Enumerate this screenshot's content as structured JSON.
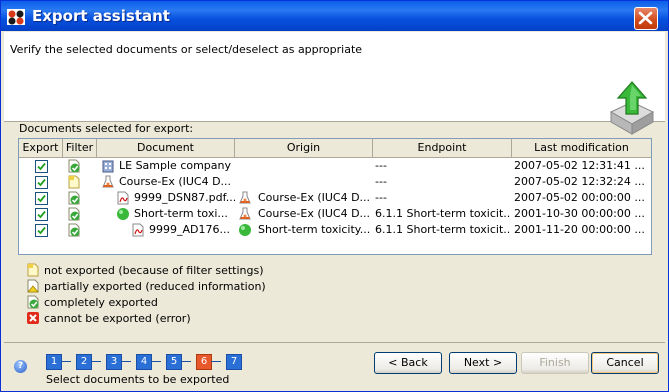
{
  "window": {
    "title": "Export assistant"
  },
  "header": {
    "instruction": "Verify the selected documents or select/deselect as appropriate"
  },
  "table": {
    "label": "Documents selected for export:",
    "columns": [
      "Export",
      "Filter",
      "Document",
      "Origin",
      "Endpoint",
      "Last modification"
    ],
    "rows": [
      {
        "export": true,
        "filter": "completely-exported",
        "doc_icon": "company-icon",
        "document": "LE Sample company",
        "origin_icon": "",
        "origin": "",
        "endpoint": "---",
        "modified": "2007-05-02 12:31:41 ..."
      },
      {
        "export": true,
        "filter": "not-exported",
        "doc_icon": "flask-icon",
        "document": "Course-Ex (IUC4 D...",
        "origin_icon": "",
        "origin": "",
        "endpoint": "---",
        "modified": "2007-05-02 12:32:24 ..."
      },
      {
        "export": true,
        "filter": "completely-exported",
        "doc_icon": "pdf-icon",
        "document": "9999_DSN87.pdf...",
        "origin_icon": "flask-icon",
        "origin": "Course-Ex (IUC4 D...",
        "endpoint": "---",
        "modified": "2007-05-02 00:00:00 ..."
      },
      {
        "export": true,
        "filter": "completely-exported",
        "doc_icon": "green-ball-icon",
        "document": "Short-term toxi...",
        "origin_icon": "flask-icon",
        "origin": "Course-Ex (IUC4 D...",
        "endpoint": "6.1.1 Short-term toxicit...",
        "modified": "2001-10-30 00:00:00 ..."
      },
      {
        "export": true,
        "filter": "completely-exported",
        "doc_icon": "pdf-icon",
        "document": "9999_AD176...",
        "origin_icon": "green-ball-icon",
        "origin": "Short-term toxicity...",
        "endpoint": "6.1.1 Short-term toxicit...",
        "modified": "2001-11-20 00:00:00 ..."
      }
    ]
  },
  "legend": [
    {
      "icon": "not-exported-icon",
      "label": "not exported (because of filter settings)"
    },
    {
      "icon": "partially-exported-icon",
      "label": "partially exported (reduced information)"
    },
    {
      "icon": "completely-exported-icon",
      "label": "completely exported"
    },
    {
      "icon": "error-icon",
      "label": "cannot be exported (error)"
    }
  ],
  "wizard": {
    "steps": [
      "1",
      "2",
      "3",
      "4",
      "5",
      "6",
      "7"
    ],
    "active_step": "6",
    "caption": "Select documents to be exported"
  },
  "buttons": {
    "back": "< Back",
    "next": "Next >",
    "finish": "Finish",
    "cancel": "Cancel"
  },
  "colors": {
    "titlebar": "#0a5fe8",
    "step_blue": "#2a6fd6",
    "step_active": "#e8582a",
    "check_green": "#3aa83a"
  }
}
